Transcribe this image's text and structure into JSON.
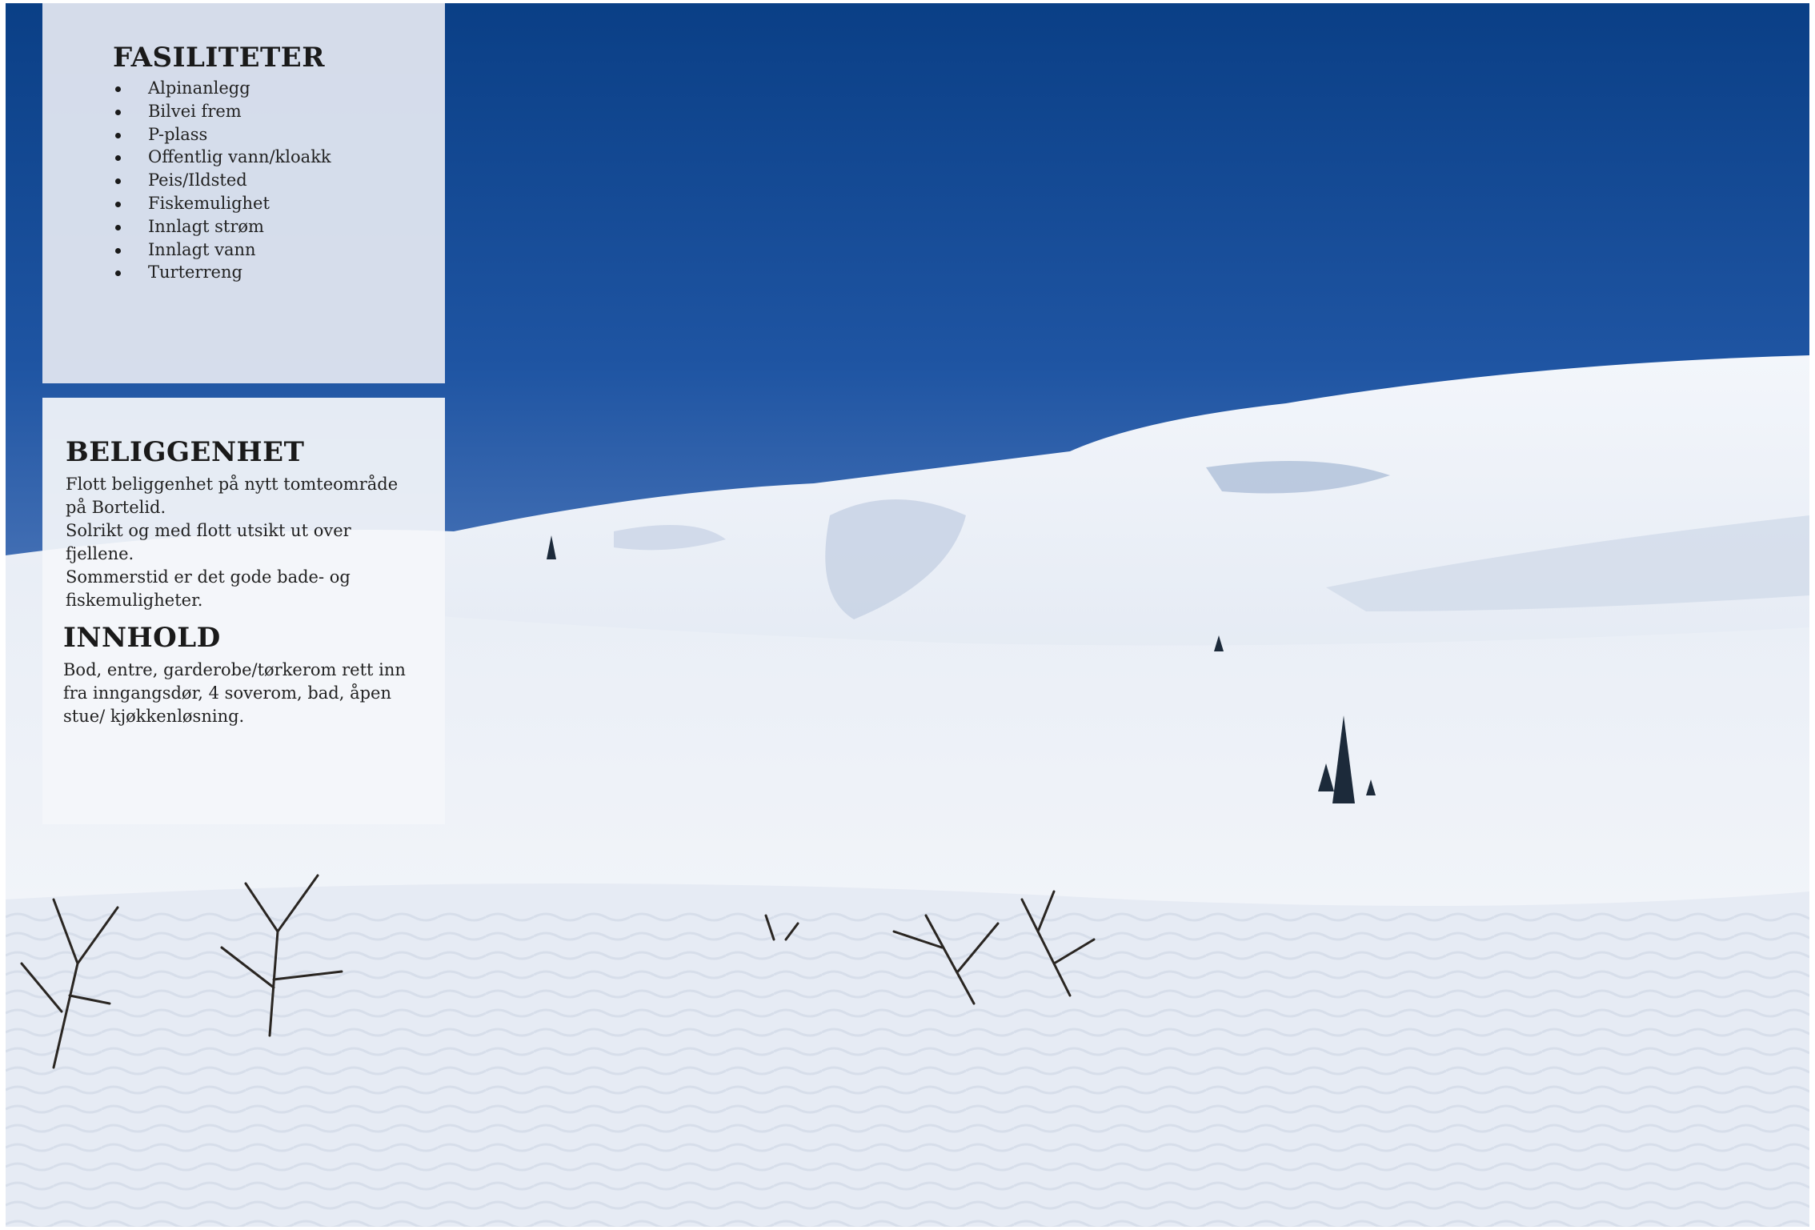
{
  "fasiliteter": {
    "title": "FASILITETER",
    "items": [
      "Alpinanlegg",
      "Bilvei frem",
      "P-plass",
      "Offentlig vann/kloakk",
      "Peis/Ildsted",
      "Fiskemulighet",
      "Innlagt strøm",
      "Innlagt vann",
      "Turterreng"
    ]
  },
  "beliggenhet": {
    "title": "BELIGGENHET",
    "lines": [
      "Flott beliggenhet på nytt tomteområde på Bortelid.",
      "Solrikt og med flott utsikt ut over fjellene.",
      "Sommerstid er det gode bade- og fiskemuligheter."
    ]
  },
  "innhold": {
    "title": "INNHOLD",
    "text": "Bod, entre, garderobe/tørkerom rett inn fra inngangsdør, 4 soverom, bad, åpen stue/ kjøkkenløsning."
  },
  "colors": {
    "sky_top": "#0a3f86",
    "sky_bottom": "#3e6ab2",
    "snow": "#eef1f7",
    "panel_top": "#dee3ee",
    "panel_bottom": "#f4f6fa"
  }
}
